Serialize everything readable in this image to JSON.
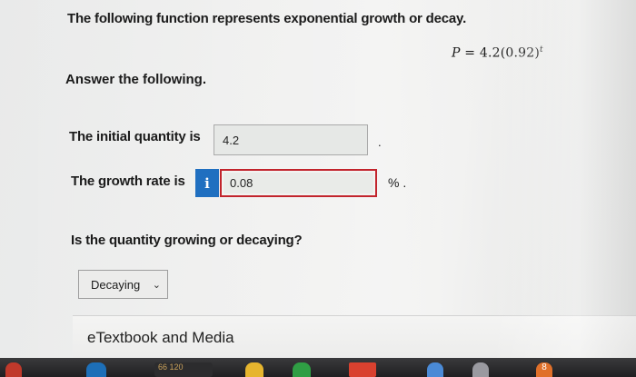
{
  "question": {
    "prompt": "The following function represents exponential growth or decay.",
    "equation": {
      "lhs": "P",
      "equals": " = ",
      "rhs": "4.2(0.92)",
      "exponent": "t"
    },
    "instruction": "Answer the following."
  },
  "fields": {
    "initial_label": "The initial quantity is",
    "initial_value": "4.2",
    "initial_suffix": ".",
    "growth_label": "The growth rate is",
    "growth_info_glyph": "i",
    "growth_value": "0.08",
    "growth_suffix": "% ."
  },
  "decay": {
    "label": "Is the quantity growing or decaying?",
    "selected": "Decaying",
    "chevron": "⌄"
  },
  "resources": {
    "label": "eTextbook and Media"
  },
  "taskbar": {
    "item_c_text": "66 120",
    "item_i_text": "8"
  },
  "colors": {
    "info_badge": "#1f6fc0",
    "error_border": "#c2242c"
  },
  "icons": {
    "info": "info-icon",
    "dropdown": "chevron-down-icon"
  }
}
